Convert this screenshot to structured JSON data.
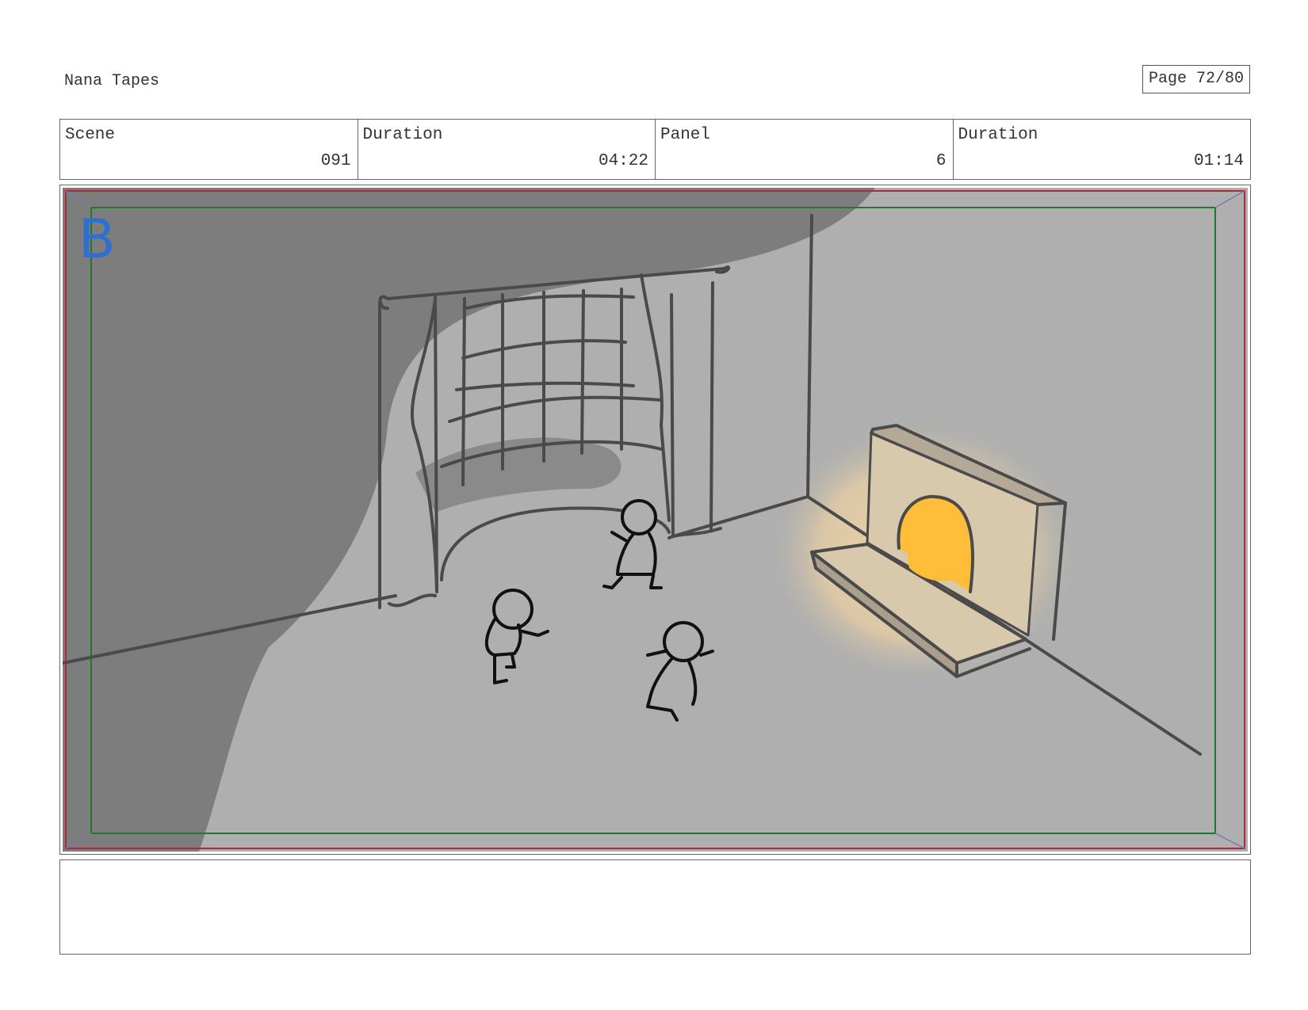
{
  "header": {
    "project_title": "Nana Tapes",
    "page_label": "Page 72/80"
  },
  "info": {
    "scene_label": "Scene",
    "scene_value": "091",
    "scene_duration_label": "Duration",
    "scene_duration_value": "04:22",
    "panel_label": "Panel",
    "panel_value": "6",
    "panel_duration_label": "Duration",
    "panel_duration_value": "01:14"
  },
  "panel": {
    "layer_letter": "B"
  },
  "notes": {
    "text": ""
  },
  "colors": {
    "wall": "#afafaf",
    "shadow": "#7d7d7d",
    "safe_frame": "#1e7a2a",
    "outer_frame": "#b0283a",
    "fire": "#ffbd3a",
    "letter": "#2f6fd0"
  }
}
